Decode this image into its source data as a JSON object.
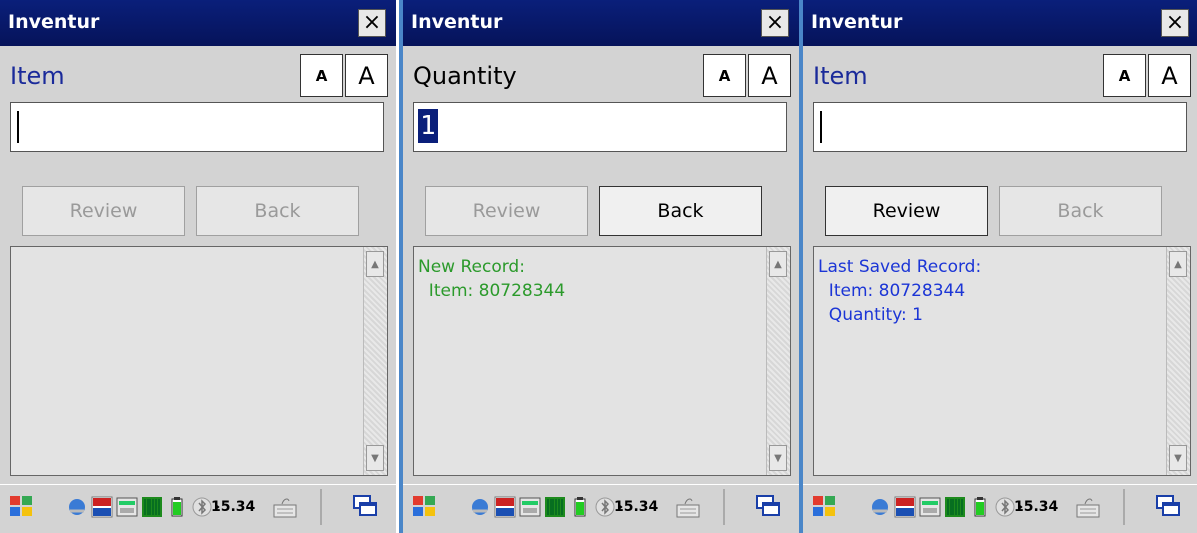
{
  "colors": {
    "titlebar": "#0a1f7a",
    "label_blue": "#1a2a9a",
    "new_record_green": "#2b9a2b",
    "saved_record_blue": "#1b35d6",
    "divider": "#4a86c8"
  },
  "panels": [
    {
      "title": "Inventur",
      "close": "×",
      "field_label": "Item",
      "field_label_color": "#1a2a9a",
      "font_small": "A",
      "font_large": "A",
      "input_value": "",
      "buttons": {
        "review": "Review",
        "back": "Back",
        "review_enabled": false,
        "back_enabled": false
      },
      "log": [],
      "log_color": "#1b35d6",
      "clock": "15.34"
    },
    {
      "title": "Inventur",
      "close": "×",
      "field_label": "Quantity",
      "field_label_color": "#000000",
      "font_small": "A",
      "font_large": "A",
      "input_value": "1",
      "buttons": {
        "review": "Review",
        "back": "Back",
        "review_enabled": false,
        "back_enabled": true
      },
      "log": [
        "New Record:",
        "  Item: 80728344"
      ],
      "log_color": "#2b9a2b",
      "clock": "15.34"
    },
    {
      "title": "Inventur",
      "close": "×",
      "field_label": "Item",
      "field_label_color": "#1a2a9a",
      "font_small": "A",
      "font_large": "A",
      "input_value": "",
      "buttons": {
        "review": "Review",
        "back": "Back",
        "review_enabled": true,
        "back_enabled": false
      },
      "log": [
        "Last Saved Record:",
        "  Item: 80728344",
        "  Quantity: 1"
      ],
      "log_color": "#1b35d6",
      "clock": "15.34"
    }
  ],
  "taskbar_icons": [
    "start-icon",
    "network-icon",
    "efon-vrc-icon",
    "keypad-123-icon",
    "barcode-icon",
    "battery-icon",
    "bluetooth-icon",
    "arrow-icon",
    "keyboard-icon",
    "windows-icon"
  ]
}
